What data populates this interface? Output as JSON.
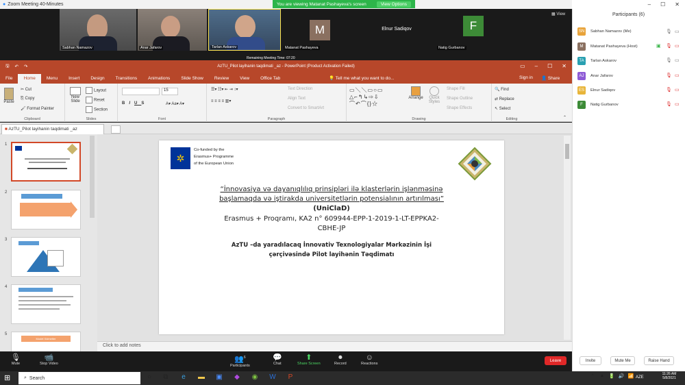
{
  "zoom": {
    "window_title": "Zoom Meeting 40-Minutes",
    "viewing_banner": "You are viewing Matanat Pashayeva's screen",
    "view_options": "View Options",
    "view_label": "View",
    "remaining": "Remaining Meeting Time: 07:20",
    "videos": [
      {
        "name": "Sabhan Namazov"
      },
      {
        "name": "Anar Jafarov"
      },
      {
        "name": "Tarlan Askarov"
      },
      {
        "name": "Matanat Pashayeva",
        "initial": "M",
        "color": "#8a7060"
      },
      {
        "name": "Elnur Sadiqov"
      },
      {
        "name": "Natig Gurbanov",
        "initial": "F",
        "color": "#3d8b37"
      }
    ],
    "toolbar": {
      "mute": "Mute",
      "stop_video": "Stop Video",
      "participants": "Participants",
      "participants_count": "6",
      "chat": "Chat",
      "share_screen": "Share Screen",
      "record": "Record",
      "reactions": "Reactions",
      "leave": "Leave"
    }
  },
  "powerpoint": {
    "title": "AzTU_Pilot layihanin taqdimati _az  -  PowerPoint (Product Activation Failed)",
    "tabs": [
      "File",
      "Home",
      "Menu",
      "Insert",
      "Design",
      "Transitions",
      "Animations",
      "Slide Show",
      "Review",
      "View",
      "Office Tab"
    ],
    "tell_me": "Tell me what you want to do...",
    "sign_in": "Sign in",
    "share": "Share",
    "ribbon": {
      "paste": "Paste",
      "cut": "Cut",
      "copy": "Copy",
      "format_painter": "Format Painter",
      "clipboard": "Clipboard",
      "new_slide": "New Slide",
      "layout": "Layout",
      "reset": "Reset",
      "section": "Section",
      "slides": "Slides",
      "font_size": "15",
      "font": "Font",
      "text_direction": "Text Direction",
      "align_text": "Align Text",
      "convert_smartart": "Convert to SmartArt",
      "paragraph": "Paragraph",
      "arrange": "Arrange",
      "quick_styles": "Quick Styles",
      "shape_fill": "Shape Fill",
      "shape_outline": "Shape Outline",
      "shape_effects": "Shape Effects",
      "drawing": "Drawing",
      "find": "Find",
      "replace": "Replace",
      "select": "Select",
      "editing": "Editing"
    },
    "doc_tab": "AzTU_Pilot layihanin taqdimati _az",
    "thumb_numbers": [
      "1",
      "2",
      "3",
      "4",
      "5"
    ],
    "thumb5_label": "Model Xidmetler",
    "notes_placeholder": "Click to add notes",
    "slide": {
      "eu_line1": "Co-funded by the",
      "eu_line2": "Erasmus+ Programme",
      "eu_line3": "of the European Union",
      "line1": "“İnnovasiya və dayanıqlılıq prinsipləri ilə klasterlərin işlənməsinə",
      "line2": "başlamaqda və iştirakda  universitetlərin potensialının artırılması”",
      "line3": "(UniClaD)",
      "line4": "Erasmus + Proqramı,  KA2 n° 609944-EPP-1-2019-1-LT-EPPKA2-",
      "line5": "CBHE-JP",
      "line6": "AzTU –da yaradılacaq İnnovativ Texnologiyalar Mərkəzinin İşi",
      "line7": "çərçivəsində Pilot layihənin Təqdimatı"
    }
  },
  "participants_panel": {
    "title": "Participants (6)",
    "list": [
      {
        "initials": "SN",
        "name": "Sabhan Namazov (Me)",
        "color": "#e8a33a"
      },
      {
        "initials": "M",
        "name": "Matanat Pashayeva (Host)",
        "color": "#8a7060"
      },
      {
        "initials": "TA",
        "name": "Tarlan Askarov",
        "color": "#29a0b1"
      },
      {
        "initials": "AJ",
        "name": "Anar Jafarov",
        "color": "#8e5bd6"
      },
      {
        "initials": "ES",
        "name": "Elnur Sadiqov",
        "color": "#e8b53a"
      },
      {
        "initials": "F",
        "name": "Natig Gurbanov",
        "color": "#3d8b37"
      }
    ],
    "invite": "Invite",
    "mute_me": "Mute Me",
    "raise_hand": "Raise Hand"
  },
  "taskbar": {
    "search": "Search",
    "lang": "AZE",
    "time": "11:26 AM",
    "date": "5/8/2021"
  }
}
